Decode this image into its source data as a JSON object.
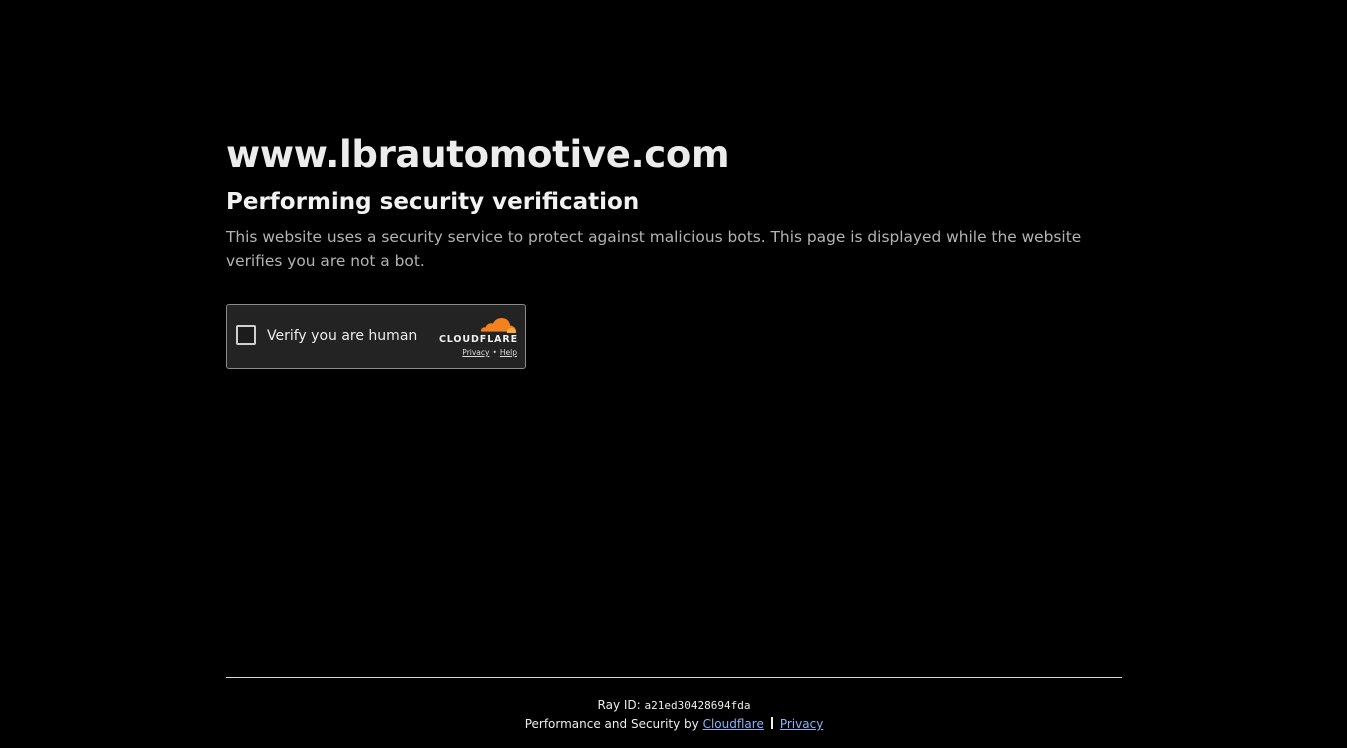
{
  "site": {
    "domain": "www.lbrautomotive.com"
  },
  "main": {
    "heading": "Performing security verification",
    "description": "This website uses a security service to protect against malicious bots. This page is displayed while the website verifies you are not a bot."
  },
  "widget": {
    "checkbox_label": "Verify you are human",
    "checked": false,
    "brand": "CLOUDFLARE",
    "privacy_link": "Privacy",
    "separator": "•",
    "help_link": "Help",
    "cloud_color": "#f48120",
    "cloud_light_color": "#faad3f"
  },
  "footer": {
    "ray_label": "Ray ID:",
    "ray_id": "a21ed30428694fda",
    "performance_text": "Performance and Security by",
    "cloudflare_link": "Cloudflare",
    "privacy_link": "Privacy",
    "link_color": "#8ab4f8"
  }
}
